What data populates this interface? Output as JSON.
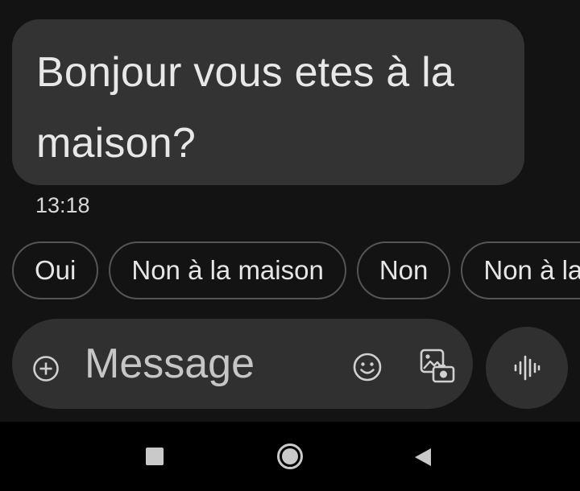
{
  "conversation": {
    "incoming_message": {
      "text": "Bonjour vous etes à la maison?",
      "time": "13:18"
    }
  },
  "smart_replies": [
    {
      "label": "Oui"
    },
    {
      "label": "Non à la maison"
    },
    {
      "label": "Non"
    },
    {
      "label": "Non à la maison"
    }
  ],
  "composer": {
    "placeholder": "Message",
    "icons": {
      "add": "plus-circle-icon",
      "emoji": "smiley-icon",
      "gallery": "gallery-camera-icon",
      "voice": "voice-waveform-icon"
    }
  },
  "navigation_bar": {
    "icons": [
      "recent-apps-icon",
      "home-icon",
      "back-icon"
    ]
  },
  "colors": {
    "background": "#131313",
    "bubble": "#333333",
    "chip_border": "#555555",
    "composer": "#303030",
    "nav_background": "#000000"
  }
}
